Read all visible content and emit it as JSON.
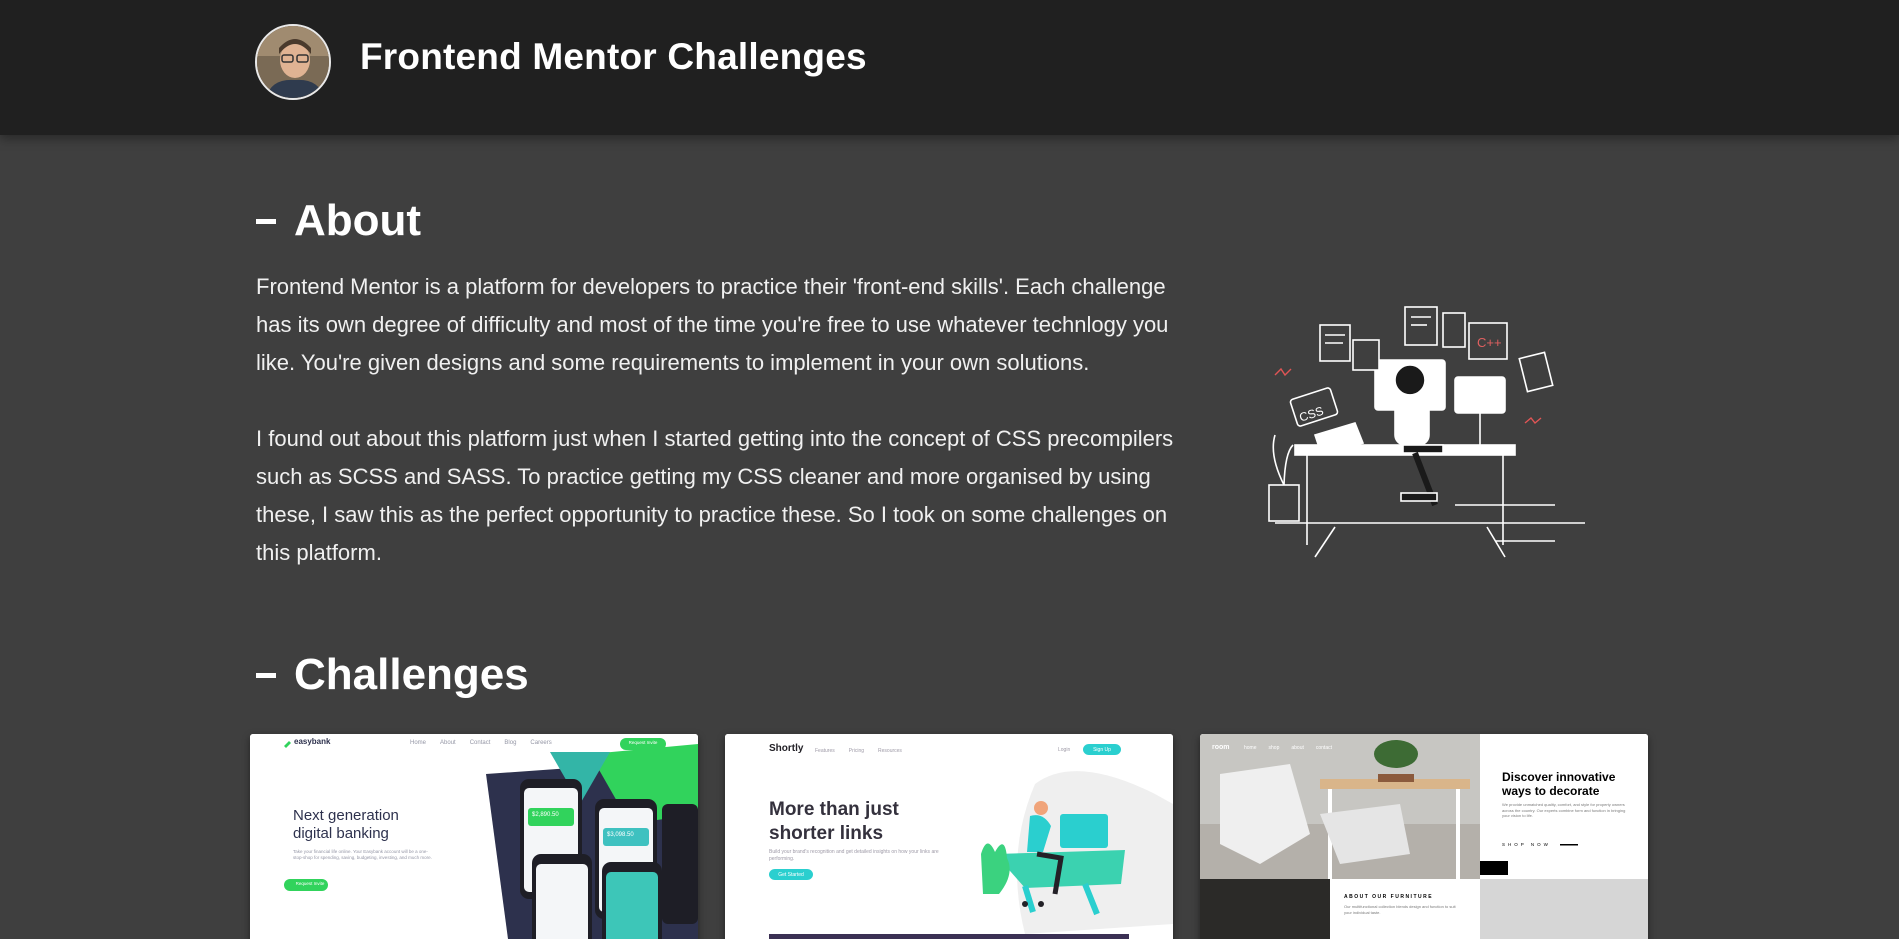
{
  "header": {
    "title": "Frontend Mentor Challenges",
    "avatar_icon": "profile-photo"
  },
  "about": {
    "heading": "About",
    "paragraphs": [
      "Frontend Mentor is a platform for developers to practice their 'front-end skills'. Each challenge has its own degree of difficulty and most of the time you're free to use whatever technlogy you like. You're given designs and some requirements to implement in your own solutions.",
      "I found out about this platform just when I started getting into the concept of CSS precompilers such as SCSS and SASS. To practice getting my CSS cleaner and more organised by using these, I saw this as the perfect opportunity to practice these. So I took on some challenges on this platform."
    ],
    "illustration_labels": {
      "laptop": "CSS",
      "sheet": "C++"
    }
  },
  "challenges": {
    "heading": "Challenges",
    "cards": [
      {
        "brand": "easybank",
        "nav": [
          "Home",
          "About",
          "Contact",
          "Blog",
          "Careers"
        ],
        "cta": "Request Invite",
        "headline_1": "Next generation",
        "headline_2": "digital banking",
        "body": "Take your financial life online. Your Easybank account will be a one-stop-shop for spending, saving, budgeting, investing, and much more.",
        "button": "Request Invite",
        "amount_1": "$2,890.50",
        "amount_2": "$3,098.50",
        "accent": "#31d35c"
      },
      {
        "brand": "Shortly",
        "nav": [
          "Features",
          "Pricing",
          "Resources"
        ],
        "login": "Login",
        "signup": "Sign Up",
        "headline_1": "More than just",
        "headline_2": "shorter links",
        "body": "Build your brand's recognition and get detailed insights on how your links are performing.",
        "button": "Get Started",
        "accent": "#2acfcf"
      },
      {
        "brand": "room",
        "nav": [
          "home",
          "shop",
          "about",
          "contact"
        ],
        "headline_1": "Discover innovative",
        "headline_2": "ways to decorate",
        "body": "We provide unmatched quality, comfort, and style for property owners across the country. Our experts combine form and function in bringing your vision to life.",
        "shop": "SHOP NOW",
        "section": "ABOUT OUR FURNITURE",
        "section_body": "Our multifunctional collection blends design and function to suit your individual taste."
      }
    ]
  }
}
